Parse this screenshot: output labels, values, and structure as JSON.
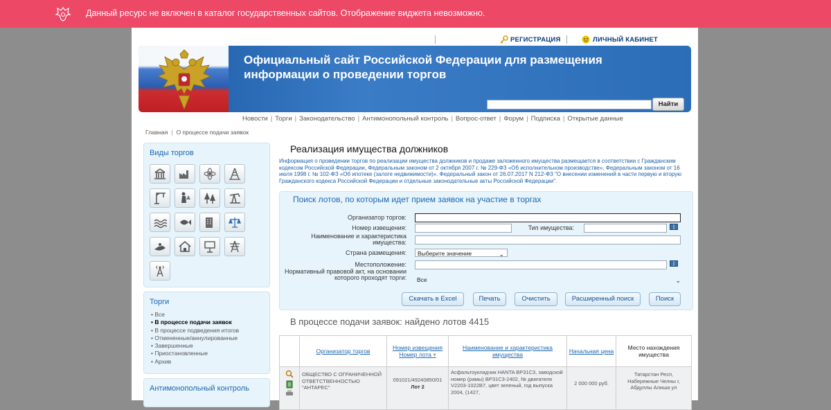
{
  "alert": {
    "message": "Данный ресурс не включен в каталог государственных сайтов. Отображение виджета невозможно."
  },
  "userlinks": {
    "register": "РЕГИСТРАЦИЯ",
    "cabinet": "ЛИЧНЫЙ КАБИНЕТ"
  },
  "banner": {
    "title": "Официальный сайт Российской Федерации для размещения информации о проведении торгов",
    "search_button": "Найти",
    "search_value": ""
  },
  "nav": [
    "Новости",
    "Торги",
    "Законодательство",
    "Антимонопольный контроль",
    "Вопрос-ответ",
    "Форум",
    "Подписка",
    "Открытые данные"
  ],
  "breadcrumb": [
    "Главная",
    "О процессе подачи заявок"
  ],
  "sidebar": {
    "types_title": "Виды торгов",
    "type_icons": [
      "building-icon",
      "factory-icon",
      "atom-icon",
      "oil-rig-icon",
      "crane-icon",
      "forest-person-icon",
      "trees-icon",
      "pump-jack-icon",
      "water-icon",
      "fish-icon",
      "office-icon",
      "scales-icon",
      "jet-ski-icon",
      "house-icon",
      "billboard-icon",
      "power-tower-icon",
      "radio-tower-icon"
    ],
    "torgi_title": "Торги",
    "torgi_items": [
      "Все",
      "В процессе подачи заявок",
      "В процессе подведения итогов",
      "Отмененные/аннулированные",
      "Завершенные",
      "Приостановленные",
      "Архив"
    ],
    "torgi_selected": 1,
    "antimon_title": "Антимонопольный контроль"
  },
  "content": {
    "title": "Реализация имущества должников",
    "info": "Информация о проведении торгов по реализации имущества должников и продаже заложенного имущества размещается в соответствии с Гражданским кодексом Российской Федерации, Федеральным законом от 2 октября 2007 г. № 229-ФЗ «Об исполнительном производстве», Федеральным законом от 16 июля 1998 г. № 102-ФЗ «Об ипотеке (залоге недвижимости)». Федеральный закон от 26.07.2017 N 212-ФЗ \"О внесении изменений в части первую и вторую Гражданского кодекса Российской Федерации и отдельные законодательные акты Российской Федерации\"."
  },
  "search": {
    "header": "Поиск лотов, по которым идет прием заявок на участие в торгах",
    "labels": {
      "organizer": "Организатор торгов:",
      "notice_number": "Номер извещения:",
      "property_type": "Тип имущества:",
      "name": "Наименование и характеристика имущества:",
      "country": "Страна размещения:",
      "location": "Местоположение:",
      "legal_act": "Нормативный правовой акт, на основании которого проходят торги:"
    },
    "country_value": "Выберите значение",
    "legal_act_value": "Все",
    "buttons": [
      "Скачать в Excel",
      "Печать",
      "Очистить",
      "Расширенный поиск",
      "Поиск"
    ]
  },
  "results": {
    "caption": "В процессе подачи заявок: найдено лотов 4415",
    "columns": [
      "Организатор торгов",
      "Номер извещения Номер лота",
      "Наименование и характеристика имущества",
      "Начальная цена",
      "Место нахождения имущества"
    ],
    "rows": [
      {
        "organizer": "ОБЩЕСТВО С ОГРАНИЧЕННОЙ ОТВЕТСТВЕННОСТЬЮ \"АНТАРЕС\"",
        "notice": "091021/49240850/01",
        "lot": "Лот 2",
        "name": "Асфальтоукладчик HANTA BP31C3, заводской номер (рамы) BP31C3-2402, № двигателя V2203-1022B7, цвет зеленый, год выпуска 2004, (1427,",
        "price": "2 000 000 руб.",
        "location": "Татарстан Респ, Набережные Челны г, Абдуллы Алиша ул"
      }
    ]
  }
}
